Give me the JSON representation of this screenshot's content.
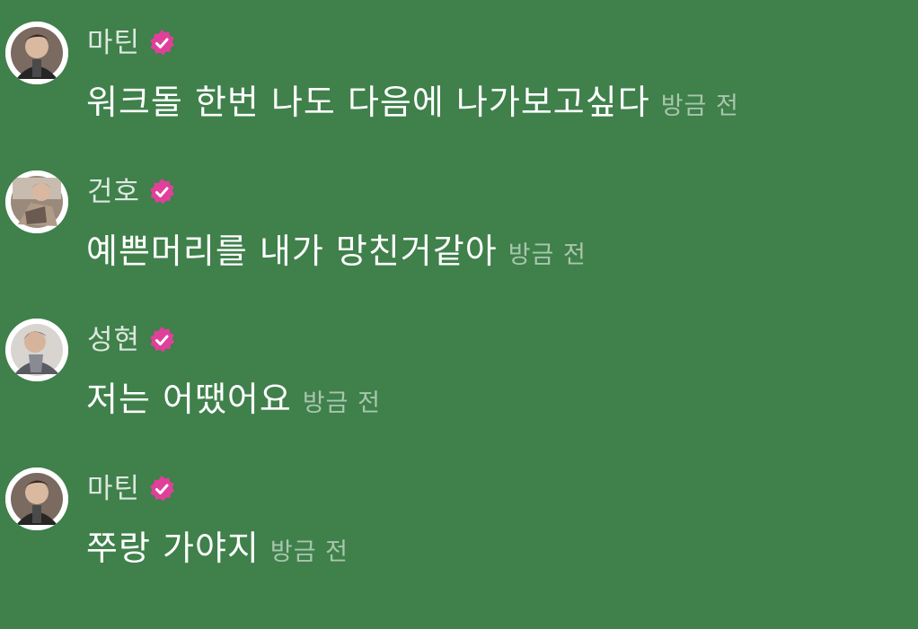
{
  "colors": {
    "background": "#3f804b",
    "verified_badge": "#e0409a",
    "message_text": "#ffffff"
  },
  "messages": [
    {
      "name": "마틴",
      "text": "워크돌 한번 나도 다음에 나가보고싶다",
      "time": "방금 전",
      "avatar_icon": "avatar-martin-icon",
      "verified_icon": "verified-badge-icon"
    },
    {
      "name": "건호",
      "text": "예쁜머리를 내가 망친거같아",
      "time": "방금 전",
      "avatar_icon": "avatar-gunho-icon",
      "verified_icon": "verified-badge-icon"
    },
    {
      "name": "성현",
      "text": "저는 어땠어요",
      "time": "방금 전",
      "avatar_icon": "avatar-seonghyeon-icon",
      "verified_icon": "verified-badge-icon"
    },
    {
      "name": "마틴",
      "text": "쭈랑 가야지",
      "time": "방금 전",
      "avatar_icon": "avatar-martin-icon",
      "verified_icon": "verified-badge-icon"
    }
  ]
}
